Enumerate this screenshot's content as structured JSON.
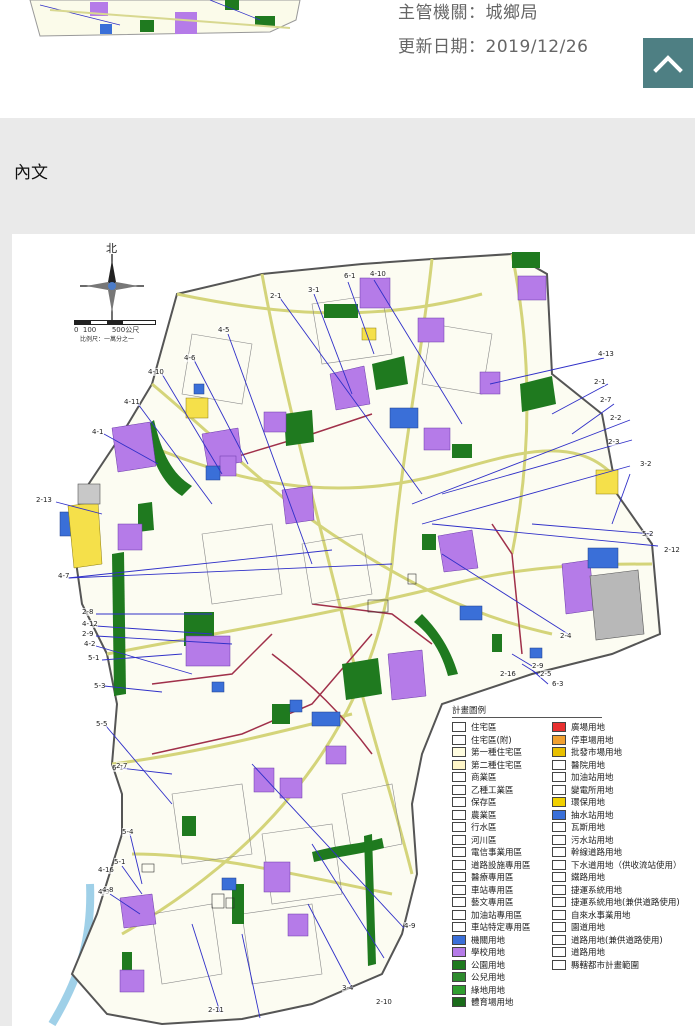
{
  "header": {
    "agency_label": "主管機關：城鄉局",
    "updated_label": "更新日期：2019/12/26"
  },
  "section": {
    "title": "內文"
  },
  "map": {
    "north_label": "北",
    "scale_numbers": "0  100       500公尺",
    "scale_note": "比例尺：一萬分之一",
    "plan_labels": [
      "6-1",
      "4-10",
      "3-1",
      "2-1",
      "4-5",
      "4-6",
      "4-10",
      "4-11",
      "4-1",
      "2-13",
      "4-13",
      "2-1",
      "2-7",
      "2-2",
      "2-3",
      "3-2",
      "5-2",
      "2-12",
      "4-7",
      "2-8",
      "4-12",
      "2-9",
      "4-2",
      "5-1",
      "5-3",
      "5-5",
      "6-1",
      "2-7",
      "2-4",
      "2-9",
      "2-5",
      "6-3",
      "2-16",
      "5-4",
      "5-1",
      "4-16",
      "4-9",
      "2-10",
      "3-4",
      "2-11",
      "4-8",
      "4-9"
    ],
    "legend": {
      "title": "計畫圖例",
      "left": [
        {
          "label": "住宅區",
          "color": "#ffffff"
        },
        {
          "label": "住宅區(附)",
          "color": "#ffffff"
        },
        {
          "label": "第一種住宅區",
          "color": "#fffde0"
        },
        {
          "label": "第二種住宅區",
          "color": "#fff6c8"
        },
        {
          "label": "商業區",
          "color": "#ffffff"
        },
        {
          "label": "乙種工業區",
          "color": "#ffffff"
        },
        {
          "label": "保存區",
          "color": "#ffffff"
        },
        {
          "label": "農業區",
          "color": "#ffffff"
        },
        {
          "label": "行水區",
          "color": "#ffffff"
        },
        {
          "label": "河川區",
          "color": "#ffffff"
        },
        {
          "label": "電信事業用區",
          "color": "#ffffff"
        },
        {
          "label": "道路設施專用區",
          "color": "#ffffff"
        },
        {
          "label": "醫療專用區",
          "color": "#ffffff"
        },
        {
          "label": "車站專用區",
          "color": "#ffffff"
        },
        {
          "label": "藝文專用區",
          "color": "#ffffff"
        },
        {
          "label": "加油站專用區",
          "color": "#ffffff"
        },
        {
          "label": "車站特定專用區",
          "color": "#ffffff"
        },
        {
          "label": "機關用地",
          "color": "#3a6fd8"
        },
        {
          "label": "學校用地",
          "color": "#b57be8"
        },
        {
          "label": "公園用地",
          "color": "#1f7a1f"
        },
        {
          "label": "公兒用地",
          "color": "#2e8b2e"
        },
        {
          "label": "綠地用地",
          "color": "#2f9e2f"
        },
        {
          "label": "體育場用地",
          "color": "#1a6b1a"
        }
      ],
      "right": [
        {
          "label": "廣場用地",
          "color": "#e83030"
        },
        {
          "label": "停車場用地",
          "color": "#f0a030"
        },
        {
          "label": "批發市場用地",
          "color": "#e8c000"
        },
        {
          "label": "醫院用地",
          "color": "#ffffff"
        },
        {
          "label": "加油站用地",
          "color": "#ffffff"
        },
        {
          "label": "變電所用地",
          "color": "#ffffff"
        },
        {
          "label": "環保用地",
          "color": "#f0d000"
        },
        {
          "label": "抽水站用地",
          "color": "#3a6fd8"
        },
        {
          "label": "瓦斯用地",
          "color": "#ffffff"
        },
        {
          "label": "污水站用地",
          "color": "#ffffff"
        },
        {
          "label": "幹線道路用地",
          "color": "#ffffff"
        },
        {
          "label": "下水道用地（供收流站使用）",
          "color": "#ffffff"
        },
        {
          "label": "鐵路用地",
          "color": "#ffffff"
        },
        {
          "label": "捷運系統用地",
          "color": "#ffffff"
        },
        {
          "label": "捷運系統用地(兼供道路使用)",
          "color": "#ffffff"
        },
        {
          "label": "自來水事業用地",
          "color": "#ffffff"
        },
        {
          "label": "園道用地",
          "color": "#ffffff"
        },
        {
          "label": "道路用地(兼供道路使用)",
          "color": "#ffffff"
        },
        {
          "label": "道路用地",
          "color": "#ffffff"
        },
        {
          "label": "縣轄都市計畫範圍",
          "color": "#ffffff"
        }
      ]
    }
  },
  "colors": {
    "gotop_bg": "#4e7f83",
    "gray_bg": "#eaeaea",
    "green": "#1f7a1f",
    "purple": "#b57be8",
    "blue": "#3a6fd8",
    "yellow": "#f5e04a",
    "road_red": "#a0304a",
    "line_blue": "#3030c8"
  },
  "icons": {
    "gotop": "chevron-up-icon",
    "compass": "compass-icon"
  }
}
